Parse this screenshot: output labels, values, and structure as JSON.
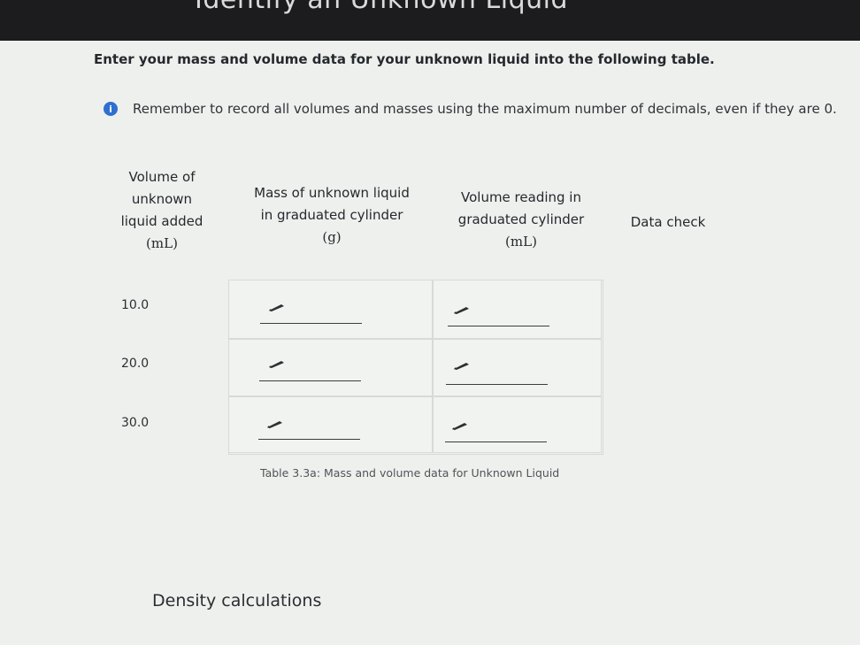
{
  "header": {
    "title": "Identify an Unknown Liquid"
  },
  "instruction": "Enter your mass and volume data for your unknown liquid into the following table.",
  "note": {
    "icon": "info-icon",
    "text": "Remember to record all volumes and masses using the maximum number of decimals, even if they are 0."
  },
  "table": {
    "columns": [
      {
        "line1": "Volume of",
        "line2": "unknown",
        "line3": "liquid added",
        "unit": "(mL)"
      },
      {
        "line1": "Mass of unknown liquid",
        "line2": "in graduated cylinder",
        "unit": "(g)"
      },
      {
        "line1": "Volume reading in",
        "line2": "graduated cylinder",
        "unit": "(mL)"
      },
      {
        "line1": "Data check"
      }
    ],
    "rows": [
      {
        "volume": "10.0",
        "mass": "",
        "reading": ""
      },
      {
        "volume": "20.0",
        "mass": "",
        "reading": ""
      },
      {
        "volume": "30.0",
        "mass": "",
        "reading": ""
      }
    ],
    "caption": "Table 3.3a: Mass and volume data for Unknown Liquid"
  },
  "section": {
    "title": "Density calculations"
  },
  "colors": {
    "info": "#2f6fcf",
    "topbar": "#1c1c1e"
  }
}
